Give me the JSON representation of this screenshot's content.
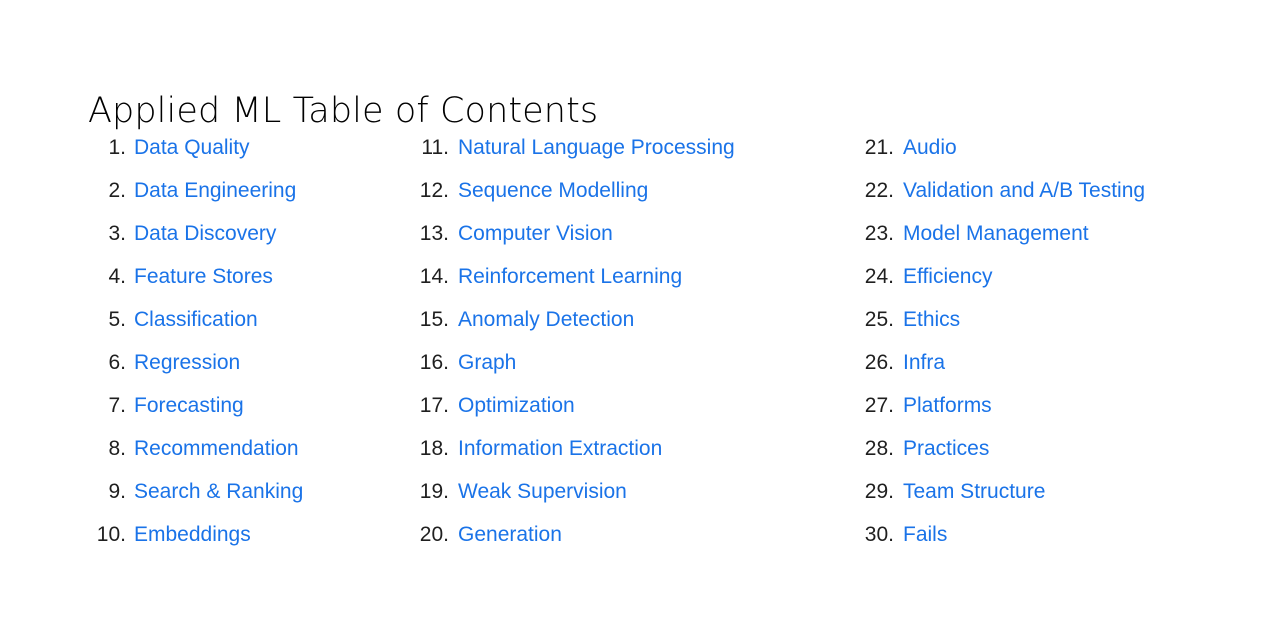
{
  "document": {
    "title": "Applied ML Table of Contents",
    "background_color": "#ffffff",
    "number_color": "#1f1f1f",
    "link_color": "#1a73e8"
  },
  "toc": {
    "columns": [
      {
        "name": "column-1",
        "items": [
          {
            "number": "1.",
            "label": "Data Quality"
          },
          {
            "number": "2.",
            "label": "Data Engineering"
          },
          {
            "number": "3.",
            "label": "Data Discovery"
          },
          {
            "number": "4.",
            "label": "Feature Stores"
          },
          {
            "number": "5.",
            "label": "Classification"
          },
          {
            "number": "6.",
            "label": "Regression"
          },
          {
            "number": "7.",
            "label": "Forecasting"
          },
          {
            "number": "8.",
            "label": "Recommendation"
          },
          {
            "number": "9.",
            "label": "Search & Ranking"
          },
          {
            "number": "10.",
            "label": "Embeddings"
          }
        ]
      },
      {
        "name": "column-2",
        "items": [
          {
            "number": "11.",
            "label": "Natural Language Processing"
          },
          {
            "number": "12.",
            "label": "Sequence Modelling"
          },
          {
            "number": "13.",
            "label": "Computer Vision"
          },
          {
            "number": "14.",
            "label": "Reinforcement Learning"
          },
          {
            "number": "15.",
            "label": "Anomaly Detection"
          },
          {
            "number": "16.",
            "label": "Graph"
          },
          {
            "number": "17.",
            "label": "Optimization"
          },
          {
            "number": "18.",
            "label": "Information Extraction"
          },
          {
            "number": "19.",
            "label": "Weak Supervision"
          },
          {
            "number": "20.",
            "label": "Generation"
          }
        ]
      },
      {
        "name": "column-3",
        "items": [
          {
            "number": "21.",
            "label": "Audio"
          },
          {
            "number": "22.",
            "label": "Validation and A/B Testing"
          },
          {
            "number": "23.",
            "label": "Model Management"
          },
          {
            "number": "24.",
            "label": "Efficiency"
          },
          {
            "number": "25.",
            "label": "Ethics"
          },
          {
            "number": "26.",
            "label": "Infra"
          },
          {
            "number": "27.",
            "label": "Platforms"
          },
          {
            "number": "28.",
            "label": "Practices"
          },
          {
            "number": "29.",
            "label": "Team Structure"
          },
          {
            "number": "30.",
            "label": "Fails"
          }
        ]
      }
    ]
  }
}
